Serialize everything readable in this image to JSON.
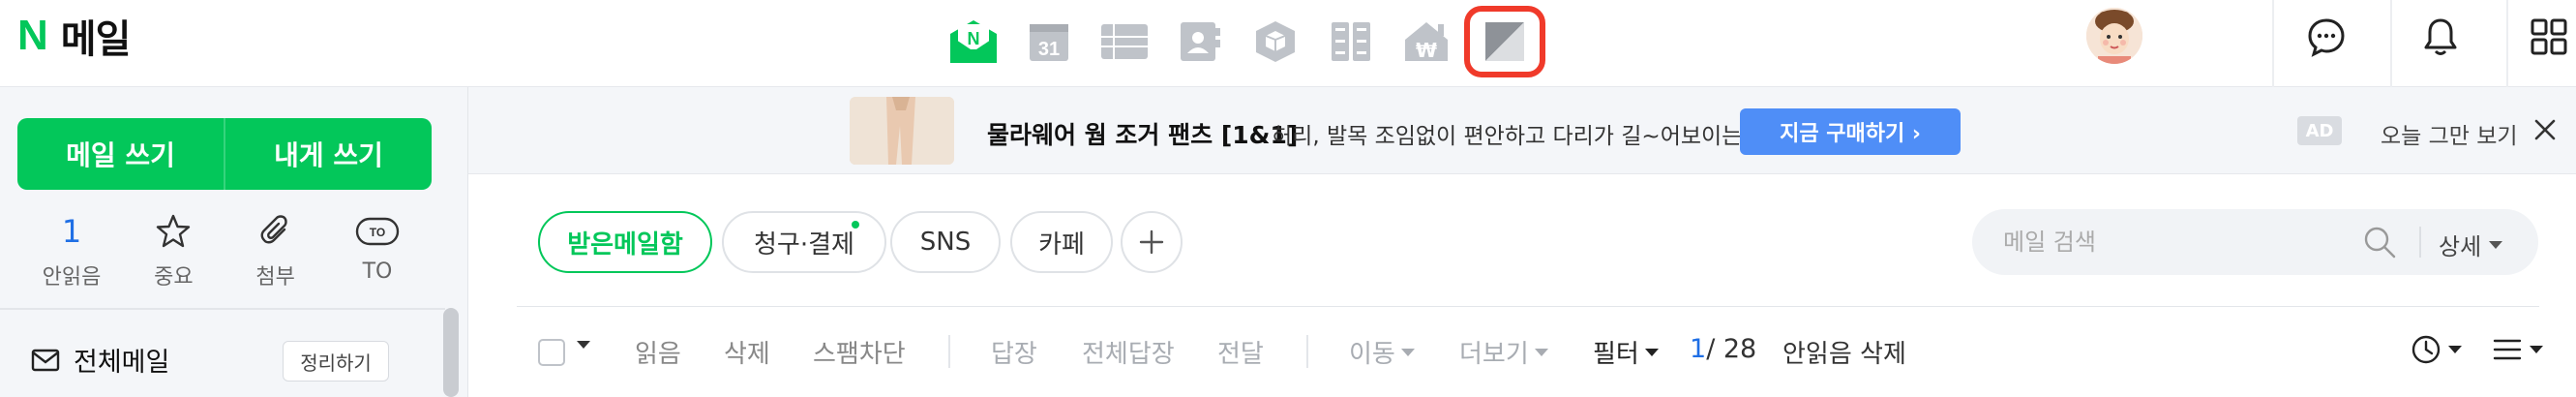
{
  "header": {
    "logo_letter": "N",
    "title": "메일",
    "apps": [
      {
        "name": "mail",
        "icon": "mail-icon"
      },
      {
        "name": "calendar",
        "icon": "calendar-icon",
        "badge": "31"
      },
      {
        "name": "list",
        "icon": "list-icon"
      },
      {
        "name": "contacts",
        "icon": "contacts-icon"
      },
      {
        "name": "box",
        "icon": "box-icon"
      },
      {
        "name": "apps-grid",
        "icon": "grid-doc-icon"
      },
      {
        "name": "pay",
        "icon": "won-house-icon",
        "badge": "₩"
      },
      {
        "name": "bookmark",
        "icon": "bookmark-k-icon",
        "selected": true
      }
    ],
    "icons": [
      "chat-icon",
      "bell-icon",
      "grid-icon"
    ]
  },
  "sidebar": {
    "compose_label": "메일 쓰기",
    "self_compose_label": "내게 쓰기",
    "quick": [
      {
        "count": "1",
        "label": "안읽음"
      },
      {
        "icon": "star-icon",
        "label": "중요"
      },
      {
        "icon": "paperclip-icon",
        "label": "첨부"
      },
      {
        "icon": "to-badge-icon",
        "badge": "TO",
        "label": "TO"
      }
    ],
    "all_mail_label": "전체메일",
    "tidy_label": "정리하기"
  },
  "ad": {
    "title": "물라웨어 웜 조거 팬츠 [1&1]",
    "description": "허리, 발목 조임없이 편안하고 다리가 길~어보이는",
    "cta": "지금 구매하기 ›",
    "badge": "AD",
    "hide_today": "오늘 그만 보기"
  },
  "tabs": [
    {
      "label": "받은메일함",
      "active": true
    },
    {
      "label": "청구·결제",
      "new_dot": true
    },
    {
      "label": "SNS"
    },
    {
      "label": "카페"
    }
  ],
  "search": {
    "placeholder": "메일 검색",
    "detail_label": "상세"
  },
  "toolbar": {
    "read": "읽음",
    "delete": "삭제",
    "spam": "스팸차단",
    "reply": "답장",
    "reply_all": "전체답장",
    "forward": "전달",
    "move": "이동",
    "more": "더보기",
    "filter": "필터",
    "unread_count": "1",
    "total": "/ 28",
    "delete_unread": "안읽음 삭제"
  },
  "colors": {
    "brand_green": "#03c75a",
    "accent_blue": "#4f8ef7",
    "count_blue": "#1f6fe5",
    "selection_red": "#f03a2a"
  }
}
